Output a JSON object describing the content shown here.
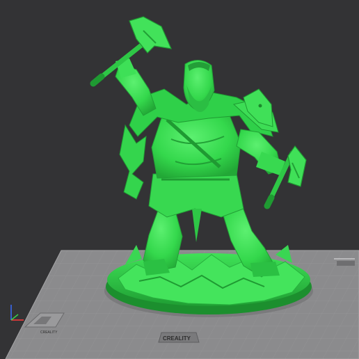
{
  "viewport": {
    "background": "#333335",
    "bed": {
      "fill": "#8c8c8e",
      "grid_color": "#9e9e9f",
      "brand_label": "CREALITY",
      "brand_icon": "creality-logo-icon"
    },
    "model": {
      "color": "#33dd4e",
      "description_icon": "viking-warrior-figure"
    },
    "axis_gizmo": {
      "x_color": "#ff3b3b",
      "y_color": "#39d24a",
      "z_color": "#3b6cff"
    }
  }
}
